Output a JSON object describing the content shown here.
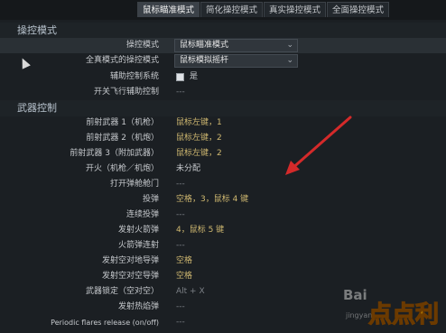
{
  "tabs": [
    {
      "label": "鼠标瞄准模式",
      "active": true
    },
    {
      "label": "简化操控模式",
      "active": false
    },
    {
      "label": "真实操控模式",
      "active": false
    },
    {
      "label": "全面操控模式",
      "active": false
    }
  ],
  "sections": {
    "control_mode": "操控模式",
    "weapons": "武器控制"
  },
  "control_rows": [
    {
      "label": "操控模式",
      "value": "鼠标瞄准模式"
    },
    {
      "label": "全真模式的操控模式",
      "value": "鼠标模拟摇杆"
    },
    {
      "label": "辅助控制系统",
      "value": "是"
    },
    {
      "label": "开关飞行辅助控制",
      "value": "---"
    }
  ],
  "weapon_rows": [
    {
      "label": "前射武器 1（机枪）",
      "value": "鼠标左键，1"
    },
    {
      "label": "前射武器 2（机炮）",
      "value": "鼠标左键，2"
    },
    {
      "label": "前射武器 3（附加武器）",
      "value": "鼠标左键，2"
    },
    {
      "label": "开火（机枪／机炮）",
      "value": "未分配"
    },
    {
      "label": "打开弹舱舱门",
      "value": "---"
    },
    {
      "label": "投弹",
      "value": "空格，3，鼠标 4 键"
    },
    {
      "label": "连续投弹",
      "value": "---"
    },
    {
      "label": "发射火箭弹",
      "value": "4，鼠标 5 键"
    },
    {
      "label": "火箭弹连射",
      "value": "---"
    },
    {
      "label": "发射空对地导弹",
      "value": "空格"
    },
    {
      "label": "发射空对空导弹",
      "value": "空格"
    },
    {
      "label": "武器锁定（空对空）",
      "value": "Alt + X"
    },
    {
      "label": "发射热焰弹",
      "value": "---"
    },
    {
      "label": "Periodic flares release (on/off)",
      "value": "---"
    }
  ],
  "watermark": {
    "text": "Bai",
    "sub": "jingyan",
    "stamp": "点点利"
  },
  "colors": {
    "accent_yellow": "#cfb870",
    "arrow_red": "#d42a2a"
  }
}
